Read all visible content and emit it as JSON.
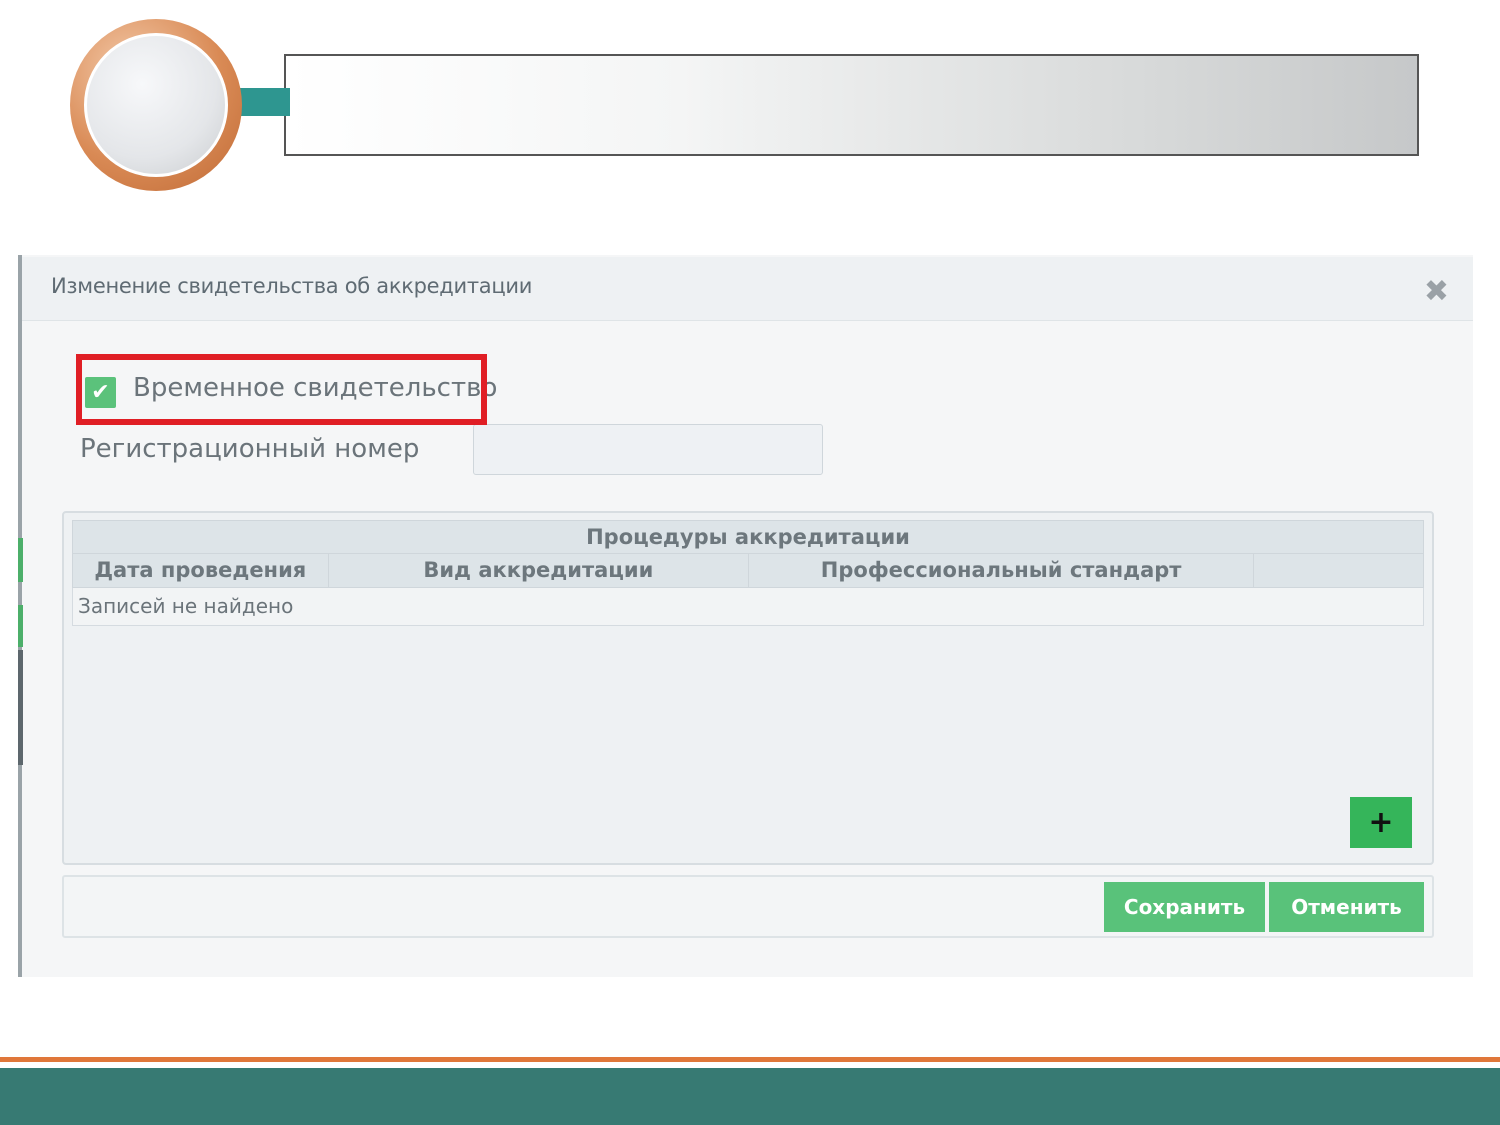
{
  "dialog": {
    "title": "Изменение свидетельства об аккредитации",
    "close_icon": "close-icon"
  },
  "form": {
    "temporary_certificate": {
      "label": "Временное свидетельство",
      "checked": true
    },
    "registration_number": {
      "label": "Регистрационный номер",
      "value": ""
    }
  },
  "procedures_table": {
    "caption": "Процедуры аккредитации",
    "columns": [
      "Дата проведения",
      "Вид аккредитации",
      "Профессиональный стандарт",
      ""
    ],
    "empty_text": "Записей не найдено",
    "add_button_label": "+"
  },
  "actions": {
    "save_label": "Сохранить",
    "cancel_label": "Отменить"
  },
  "colors": {
    "accent_green": "#35b55a",
    "button_green": "#59c27a",
    "highlight_red": "#e01e25",
    "slide_teal": "#377a73",
    "slide_orange": "#e0773a"
  }
}
